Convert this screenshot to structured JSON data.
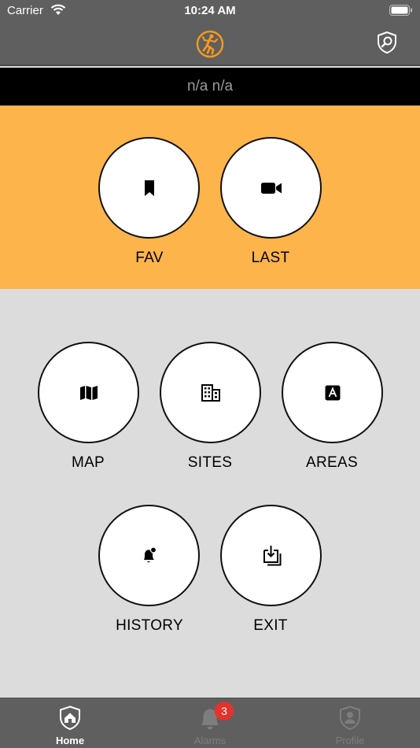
{
  "status_bar": {
    "carrier": "Carrier",
    "time": "10:24 AM"
  },
  "header": {
    "logo_icon": "runner-logo-icon",
    "action_icon": "shield-search-icon",
    "accent": "#f29a1d"
  },
  "user_bar": {
    "name": "n/a n/a"
  },
  "quick_actions": [
    {
      "label": "FAV",
      "icon": "bookmark-icon"
    },
    {
      "label": "LAST",
      "icon": "video-camera-icon"
    }
  ],
  "menu": {
    "row1": [
      {
        "label": "MAP",
        "icon": "map-icon"
      },
      {
        "label": "SITES",
        "icon": "building-icon"
      },
      {
        "label": "AREAS",
        "icon": "area-a-icon"
      }
    ],
    "row2": [
      {
        "label": "HISTORY",
        "icon": "bell-history-icon"
      },
      {
        "label": "EXIT",
        "icon": "exit-download-icon"
      }
    ]
  },
  "tab_bar": {
    "tabs": [
      {
        "label": "Home",
        "icon": "home-shield-icon",
        "active": true
      },
      {
        "label": "Alarms",
        "icon": "bell-icon",
        "active": false
      },
      {
        "label": "Profile",
        "icon": "profile-shield-icon",
        "active": false
      }
    ],
    "alarms_badge": "3"
  },
  "colors": {
    "header": "#5f5f5f",
    "quick_section": "#fdb44b",
    "main_section": "#dcdcdc",
    "badge": "#e5322d"
  }
}
